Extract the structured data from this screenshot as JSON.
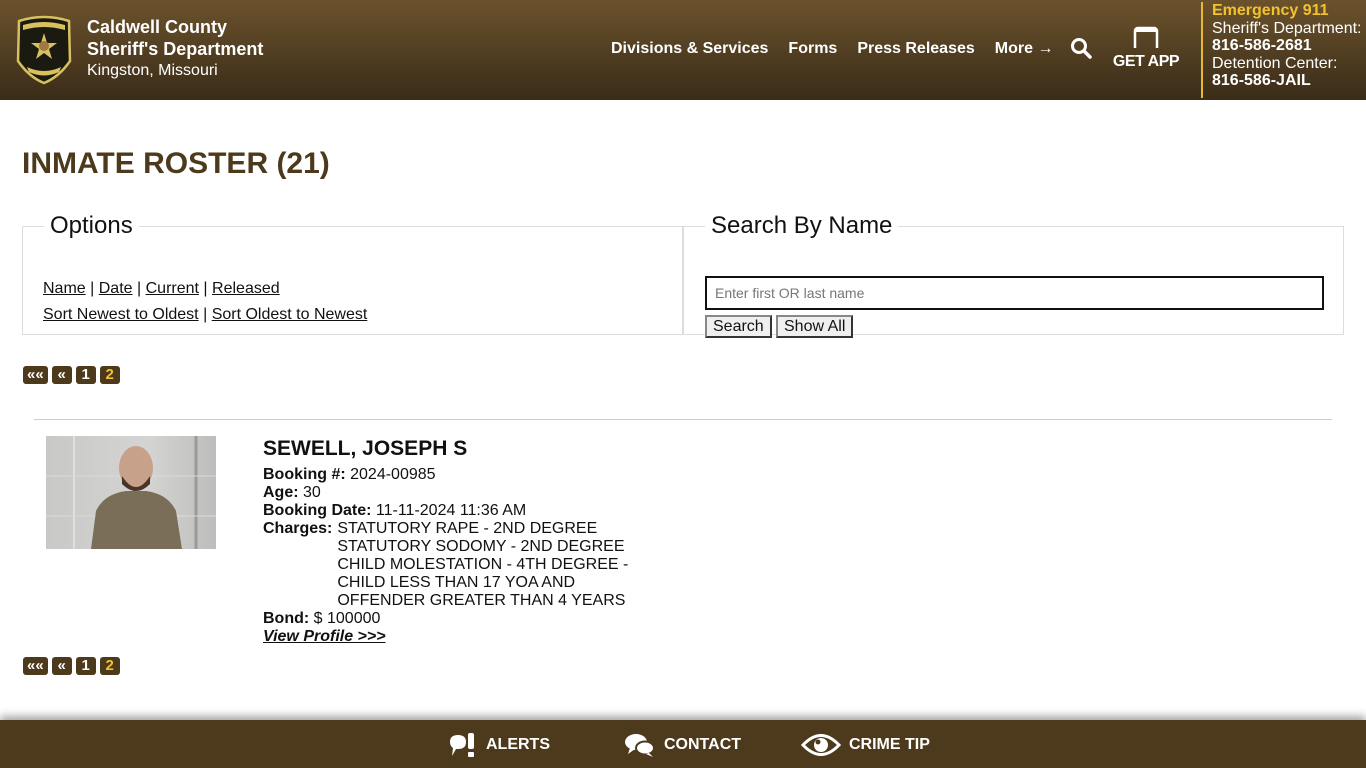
{
  "header": {
    "org_line1": "Caldwell County",
    "org_line2": "Sheriff's Department",
    "location": "Kingston, Missouri",
    "nav": [
      "Divisions & Services",
      "Forms",
      "Press Releases",
      "More →"
    ],
    "get_app": "GET APP",
    "emergency": "Emergency 911",
    "sheriff_label": "Sheriff's Department:",
    "sheriff_phone": "816-586-2681",
    "detention_label": "Detention Center:",
    "detention_phone": "816-586-JAIL",
    "accent_color": "#f2c230"
  },
  "page": {
    "title": "INMATE ROSTER (21)"
  },
  "options": {
    "legend": "Options",
    "filters": [
      "Name",
      "Date",
      "Current",
      "Released"
    ],
    "sorts": [
      "Sort Newest to Oldest",
      "Sort Oldest to Newest"
    ],
    "separator": "|"
  },
  "search": {
    "legend": "Search By Name",
    "placeholder": "Enter first OR last name",
    "value": "",
    "search_label": "Search",
    "show_all_label": "Show All"
  },
  "pagination": {
    "first": "««",
    "prev": "«",
    "pages": [
      "1",
      "2"
    ],
    "current": "2"
  },
  "inmates": [
    {
      "name": "SEWELL, JOSEPH S",
      "booking_label": "Booking #:",
      "booking": "2024-00985",
      "age_label": "Age:",
      "age": "30",
      "date_label": "Booking Date:",
      "booking_date": "11-11-2024 11:36 AM",
      "charges_label": "Charges:",
      "charges": [
        "STATUTORY RAPE - 2ND DEGREE",
        "STATUTORY SODOMY - 2ND DEGREE",
        "CHILD MOLESTATION - 4TH DEGREE -",
        "CHILD LESS THAN 17 YOA AND",
        "OFFENDER GREATER THAN 4 YEARS"
      ],
      "bond_label": "Bond:",
      "bond": "$ 100000",
      "view_profile": "View Profile >>>"
    }
  ],
  "footer": {
    "alerts": "ALERTS",
    "contact": "CONTACT",
    "crime_tip": "CRIME TIP"
  }
}
